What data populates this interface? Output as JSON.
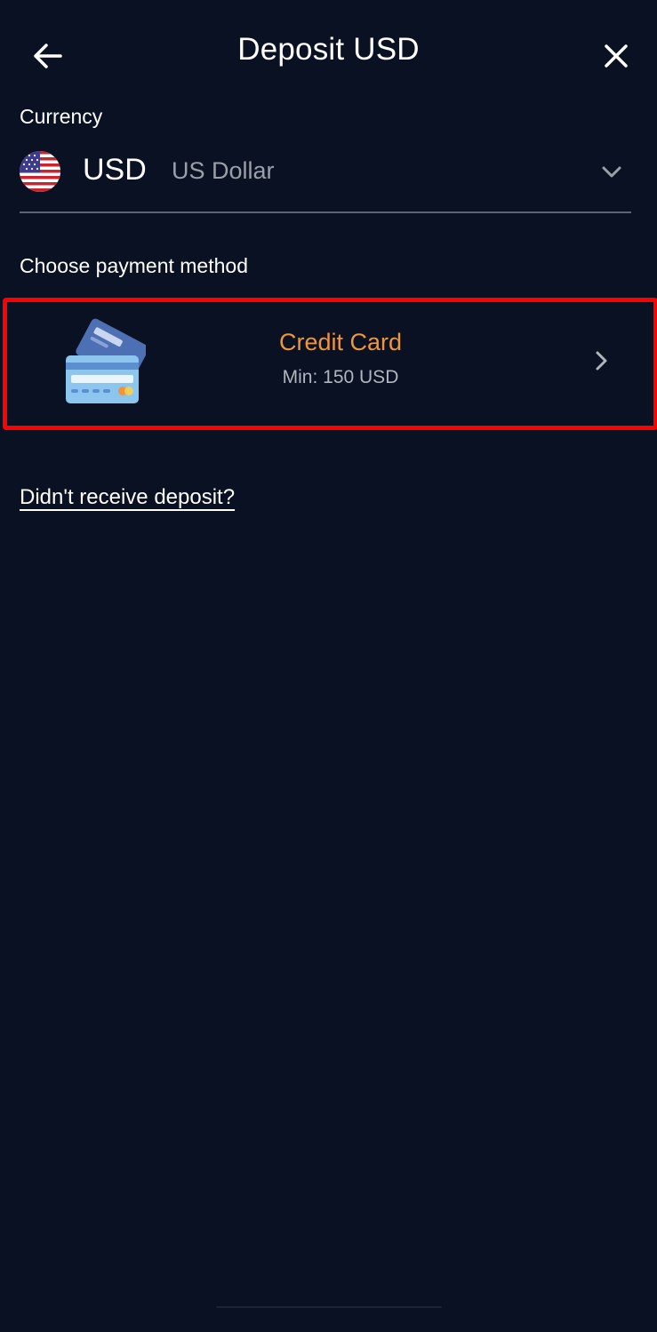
{
  "header": {
    "title": "Deposit USD",
    "back_icon": "arrow-left-icon",
    "close_icon": "close-icon"
  },
  "currency": {
    "label": "Currency",
    "code": "USD",
    "name": "US Dollar",
    "flag_icon": "us-flag-icon",
    "chevron_icon": "chevron-down-icon"
  },
  "payment": {
    "label": "Choose payment method",
    "methods": [
      {
        "name": "Credit Card",
        "min": "Min: 150 USD",
        "icon": "credit-card-icon",
        "chevron_icon": "chevron-right-icon"
      }
    ]
  },
  "help": {
    "link": "Didn't receive deposit?"
  },
  "colors": {
    "background": "#0a1122",
    "accent": "#f0953a",
    "highlight": "#ff0000",
    "muted_text": "#9aa0aa"
  }
}
